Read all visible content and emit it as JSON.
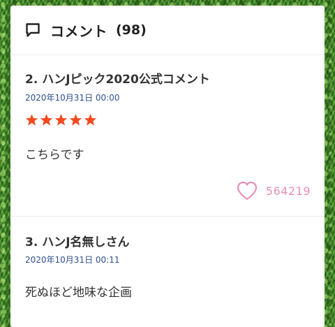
{
  "colors": {
    "star": "#f24a1d",
    "date": "#2d4f8f",
    "like": "#e98fb4",
    "text": "#333333"
  },
  "header": {
    "icon": "speech-bubble-icon",
    "title": "コメント",
    "count": "(98)"
  },
  "comments": [
    {
      "author": "2. ハンJピック2020公式コメント",
      "date": "2020年10月31日 00:00",
      "rating": 5,
      "rating_max": 5,
      "body": "こちらです",
      "like_icon": "heart-icon",
      "likes": "564219"
    },
    {
      "author": "3. ハンJ名無しさん",
      "date": "2020年10月31日 00:11",
      "body": "死ぬほど地味な企画"
    }
  ]
}
